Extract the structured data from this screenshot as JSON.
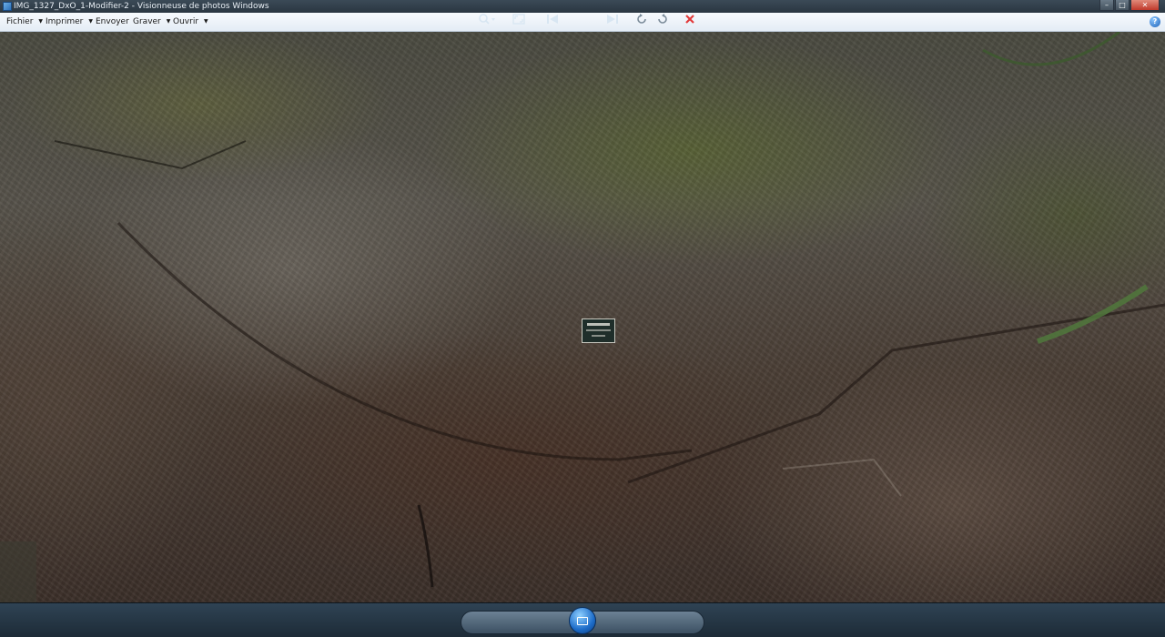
{
  "window": {
    "title": "IMG_1327_DxO_1-Modifier-2 - Visionneuse de photos Windows",
    "buttons": {
      "minimize": "–",
      "maximize": "□",
      "close": "✕"
    }
  },
  "menu": {
    "items": [
      {
        "label": "Fichier",
        "icon": "chevron-down-icon"
      },
      {
        "label": "Imprimer",
        "icon": "chevron-down-icon"
      },
      {
        "label": "Envoyer"
      },
      {
        "label": "Graver",
        "icon": "chevron-down-icon"
      },
      {
        "label": "Ouvrir",
        "icon": "chevron-down-icon"
      }
    ],
    "help": "?"
  },
  "controls": {
    "zoom_icon": "magnifier-icon",
    "fit_icon": "fit-window-icon",
    "prev_icon": "previous-icon",
    "slideshow_icon": "slideshow-icon",
    "next_icon": "next-icon",
    "rotate_left_icon": "rotate-left-icon",
    "rotate_right_icon": "rotate-right-icon",
    "delete_icon": "delete-icon"
  },
  "colors": {
    "menubar": "#e4ecf5",
    "controlbar": "#1d2b37",
    "accent": "#1d6cc9",
    "delete": "#e23a3a"
  }
}
